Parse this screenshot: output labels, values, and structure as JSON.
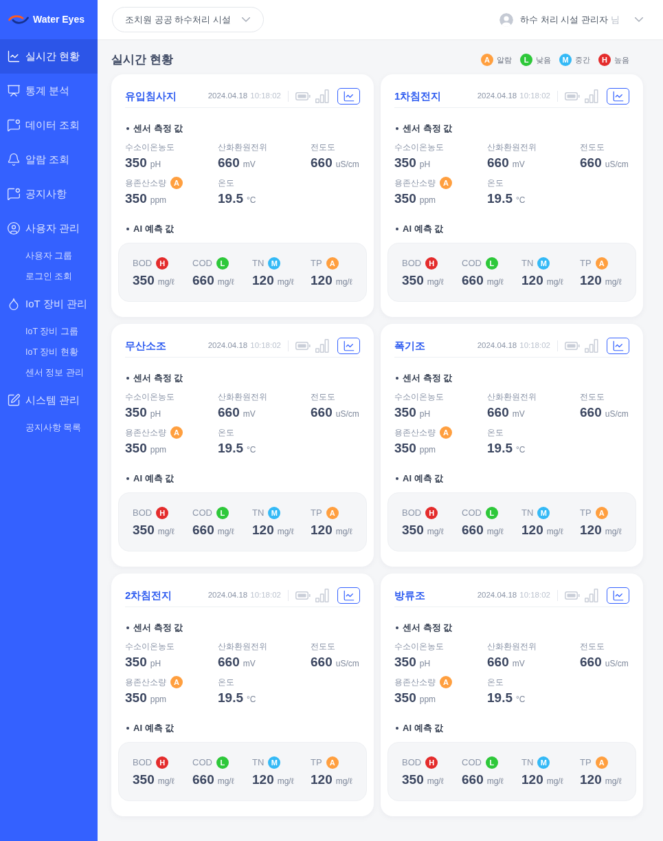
{
  "sidebar": {
    "logo": "Water Eyes",
    "items": [
      {
        "label": "실시간 현황",
        "selected": true
      },
      {
        "label": "통계 분석",
        "selected": false
      },
      {
        "label": "데이터 조회",
        "selected": false
      },
      {
        "label": "알람 조회",
        "selected": false
      },
      {
        "label": "공지사항",
        "selected": false
      },
      {
        "label": "사용자 관리",
        "selected": false,
        "children": [
          {
            "label": "사용자 그룹",
            "selected": false
          },
          {
            "label": "로그인 조회",
            "selected": false
          }
        ]
      },
      {
        "label": "IoT 장비 관리",
        "selected": false,
        "children": [
          {
            "label": "IoT 장비 그룹",
            "selected": false
          },
          {
            "label": "IoT 장비 현황",
            "selected": false
          },
          {
            "label": "센서 정보 관리",
            "selected": false
          }
        ]
      },
      {
        "label": "시스템 관리",
        "selected": false,
        "children": [
          {
            "label": "공지사항 목록",
            "selected": false
          }
        ]
      }
    ]
  },
  "header": {
    "facility_select": {
      "value": "조치원 공공 하수처리 시설"
    },
    "user": {
      "name": "하수 처리 시설 관리자",
      "suffix": "님"
    }
  },
  "page_title": "실시간 현황",
  "legend": [
    {
      "badge": "A",
      "label": "알람",
      "color": "#ff9f3f"
    },
    {
      "badge": "L",
      "label": "낮음",
      "color": "#2ec83a"
    },
    {
      "badge": "M",
      "label": "중간",
      "color": "#34b9f6"
    },
    {
      "badge": "H",
      "label": "높음",
      "color": "#e42c2c"
    }
  ],
  "cards": [
    {
      "title": "유입침사지",
      "date": "2024.04.18",
      "time": "10:18:02",
      "sensor_heading": "센서 측정 값",
      "sensors": [
        {
          "label": "수소이온농도",
          "value": "350",
          "unit": "pH"
        },
        {
          "label": "산화환원전위",
          "value": "660",
          "unit": "mV"
        },
        {
          "label": "전도도",
          "value": "660",
          "unit": "uS/cm"
        },
        {
          "label": "용존산소량",
          "badge": {
            "letter": "A",
            "color": "#ff9f3f"
          },
          "value": "350",
          "unit": "ppm"
        },
        {
          "label": "온도",
          "value": "19.5",
          "unit": "°C"
        }
      ],
      "ai_heading": "AI 예측 값",
      "predictions": [
        {
          "label": "BOD",
          "badge": {
            "letter": "H",
            "color": "#e42c2c"
          },
          "value": "350",
          "unit": "mg/ℓ"
        },
        {
          "label": "COD",
          "badge": {
            "letter": "L",
            "color": "#2ec83a"
          },
          "value": "660",
          "unit": "mg/ℓ"
        },
        {
          "label": "TN",
          "badge": {
            "letter": "M",
            "color": "#34b9f6"
          },
          "value": "120",
          "unit": "mg/ℓ"
        },
        {
          "label": "TP",
          "badge": {
            "letter": "A",
            "color": "#ff9f3f"
          },
          "value": "120",
          "unit": "mg/ℓ"
        }
      ]
    },
    {
      "title": "1차침전지",
      "date": "2024.04.18",
      "time": "10:18:02",
      "sensor_heading": "센서 측정 값",
      "sensors": [
        {
          "label": "수소이온농도",
          "value": "350",
          "unit": "pH"
        },
        {
          "label": "산화환원전위",
          "value": "660",
          "unit": "mV"
        },
        {
          "label": "전도도",
          "value": "660",
          "unit": "uS/cm"
        },
        {
          "label": "용존산소량",
          "badge": {
            "letter": "A",
            "color": "#ff9f3f"
          },
          "value": "350",
          "unit": "ppm"
        },
        {
          "label": "온도",
          "value": "19.5",
          "unit": "°C"
        }
      ],
      "ai_heading": "AI 예측 값",
      "predictions": [
        {
          "label": "BOD",
          "badge": {
            "letter": "H",
            "color": "#e42c2c"
          },
          "value": "350",
          "unit": "mg/ℓ"
        },
        {
          "label": "COD",
          "badge": {
            "letter": "L",
            "color": "#2ec83a"
          },
          "value": "660",
          "unit": "mg/ℓ"
        },
        {
          "label": "TN",
          "badge": {
            "letter": "M",
            "color": "#34b9f6"
          },
          "value": "120",
          "unit": "mg/ℓ"
        },
        {
          "label": "TP",
          "badge": {
            "letter": "A",
            "color": "#ff9f3f"
          },
          "value": "120",
          "unit": "mg/ℓ"
        }
      ]
    },
    {
      "title": "무산소조",
      "date": "2024.04.18",
      "time": "10:18:02",
      "sensor_heading": "센서 측정 값",
      "sensors": [
        {
          "label": "수소이온농도",
          "value": "350",
          "unit": "pH"
        },
        {
          "label": "산화환원전위",
          "value": "660",
          "unit": "mV"
        },
        {
          "label": "전도도",
          "value": "660",
          "unit": "uS/cm"
        },
        {
          "label": "용존산소량",
          "badge": {
            "letter": "A",
            "color": "#ff9f3f"
          },
          "value": "350",
          "unit": "ppm"
        },
        {
          "label": "온도",
          "value": "19.5",
          "unit": "°C"
        }
      ],
      "ai_heading": "AI 예측 값",
      "predictions": [
        {
          "label": "BOD",
          "badge": {
            "letter": "H",
            "color": "#e42c2c"
          },
          "value": "350",
          "unit": "mg/ℓ"
        },
        {
          "label": "COD",
          "badge": {
            "letter": "L",
            "color": "#2ec83a"
          },
          "value": "660",
          "unit": "mg/ℓ"
        },
        {
          "label": "TN",
          "badge": {
            "letter": "M",
            "color": "#34b9f6"
          },
          "value": "120",
          "unit": "mg/ℓ"
        },
        {
          "label": "TP",
          "badge": {
            "letter": "A",
            "color": "#ff9f3f"
          },
          "value": "120",
          "unit": "mg/ℓ"
        }
      ]
    },
    {
      "title": "폭기조",
      "date": "2024.04.18",
      "time": "10:18:02",
      "sensor_heading": "센서 측정 값",
      "sensors": [
        {
          "label": "수소이온농도",
          "value": "350",
          "unit": "pH"
        },
        {
          "label": "산화환원전위",
          "value": "660",
          "unit": "mV"
        },
        {
          "label": "전도도",
          "value": "660",
          "unit": "uS/cm"
        },
        {
          "label": "용존산소량",
          "badge": {
            "letter": "A",
            "color": "#ff9f3f"
          },
          "value": "350",
          "unit": "ppm"
        },
        {
          "label": "온도",
          "value": "19.5",
          "unit": "°C"
        }
      ],
      "ai_heading": "AI 예측 값",
      "predictions": [
        {
          "label": "BOD",
          "badge": {
            "letter": "H",
            "color": "#e42c2c"
          },
          "value": "350",
          "unit": "mg/ℓ"
        },
        {
          "label": "COD",
          "badge": {
            "letter": "L",
            "color": "#2ec83a"
          },
          "value": "660",
          "unit": "mg/ℓ"
        },
        {
          "label": "TN",
          "badge": {
            "letter": "M",
            "color": "#34b9f6"
          },
          "value": "120",
          "unit": "mg/ℓ"
        },
        {
          "label": "TP",
          "badge": {
            "letter": "A",
            "color": "#ff9f3f"
          },
          "value": "120",
          "unit": "mg/ℓ"
        }
      ]
    },
    {
      "title": "2차침전지",
      "date": "2024.04.18",
      "time": "10:18:02",
      "sensor_heading": "센서 측정 값",
      "sensors": [
        {
          "label": "수소이온농도",
          "value": "350",
          "unit": "pH"
        },
        {
          "label": "산화환원전위",
          "value": "660",
          "unit": "mV"
        },
        {
          "label": "전도도",
          "value": "660",
          "unit": "uS/cm"
        },
        {
          "label": "용존산소량",
          "badge": {
            "letter": "A",
            "color": "#ff9f3f"
          },
          "value": "350",
          "unit": "ppm"
        },
        {
          "label": "온도",
          "value": "19.5",
          "unit": "°C"
        }
      ],
      "ai_heading": "AI 예측 값",
      "predictions": [
        {
          "label": "BOD",
          "badge": {
            "letter": "H",
            "color": "#e42c2c"
          },
          "value": "350",
          "unit": "mg/ℓ"
        },
        {
          "label": "COD",
          "badge": {
            "letter": "L",
            "color": "#2ec83a"
          },
          "value": "660",
          "unit": "mg/ℓ"
        },
        {
          "label": "TN",
          "badge": {
            "letter": "M",
            "color": "#34b9f6"
          },
          "value": "120",
          "unit": "mg/ℓ"
        },
        {
          "label": "TP",
          "badge": {
            "letter": "A",
            "color": "#ff9f3f"
          },
          "value": "120",
          "unit": "mg/ℓ"
        }
      ]
    },
    {
      "title": "방류조",
      "date": "2024.04.18",
      "time": "10:18:02",
      "sensor_heading": "센서 측정 값",
      "sensors": [
        {
          "label": "수소이온농도",
          "value": "350",
          "unit": "pH"
        },
        {
          "label": "산화환원전위",
          "value": "660",
          "unit": "mV"
        },
        {
          "label": "전도도",
          "value": "660",
          "unit": "uS/cm"
        },
        {
          "label": "용존산소량",
          "badge": {
            "letter": "A",
            "color": "#ff9f3f"
          },
          "value": "350",
          "unit": "ppm"
        },
        {
          "label": "온도",
          "value": "19.5",
          "unit": "°C"
        }
      ],
      "ai_heading": "AI 예측 값",
      "predictions": [
        {
          "label": "BOD",
          "badge": {
            "letter": "H",
            "color": "#e42c2c"
          },
          "value": "350",
          "unit": "mg/ℓ"
        },
        {
          "label": "COD",
          "badge": {
            "letter": "L",
            "color": "#2ec83a"
          },
          "value": "660",
          "unit": "mg/ℓ"
        },
        {
          "label": "TN",
          "badge": {
            "letter": "M",
            "color": "#34b9f6"
          },
          "value": "120",
          "unit": "mg/ℓ"
        },
        {
          "label": "TP",
          "badge": {
            "letter": "A",
            "color": "#ff9f3f"
          },
          "value": "120",
          "unit": "mg/ℓ"
        }
      ]
    }
  ]
}
